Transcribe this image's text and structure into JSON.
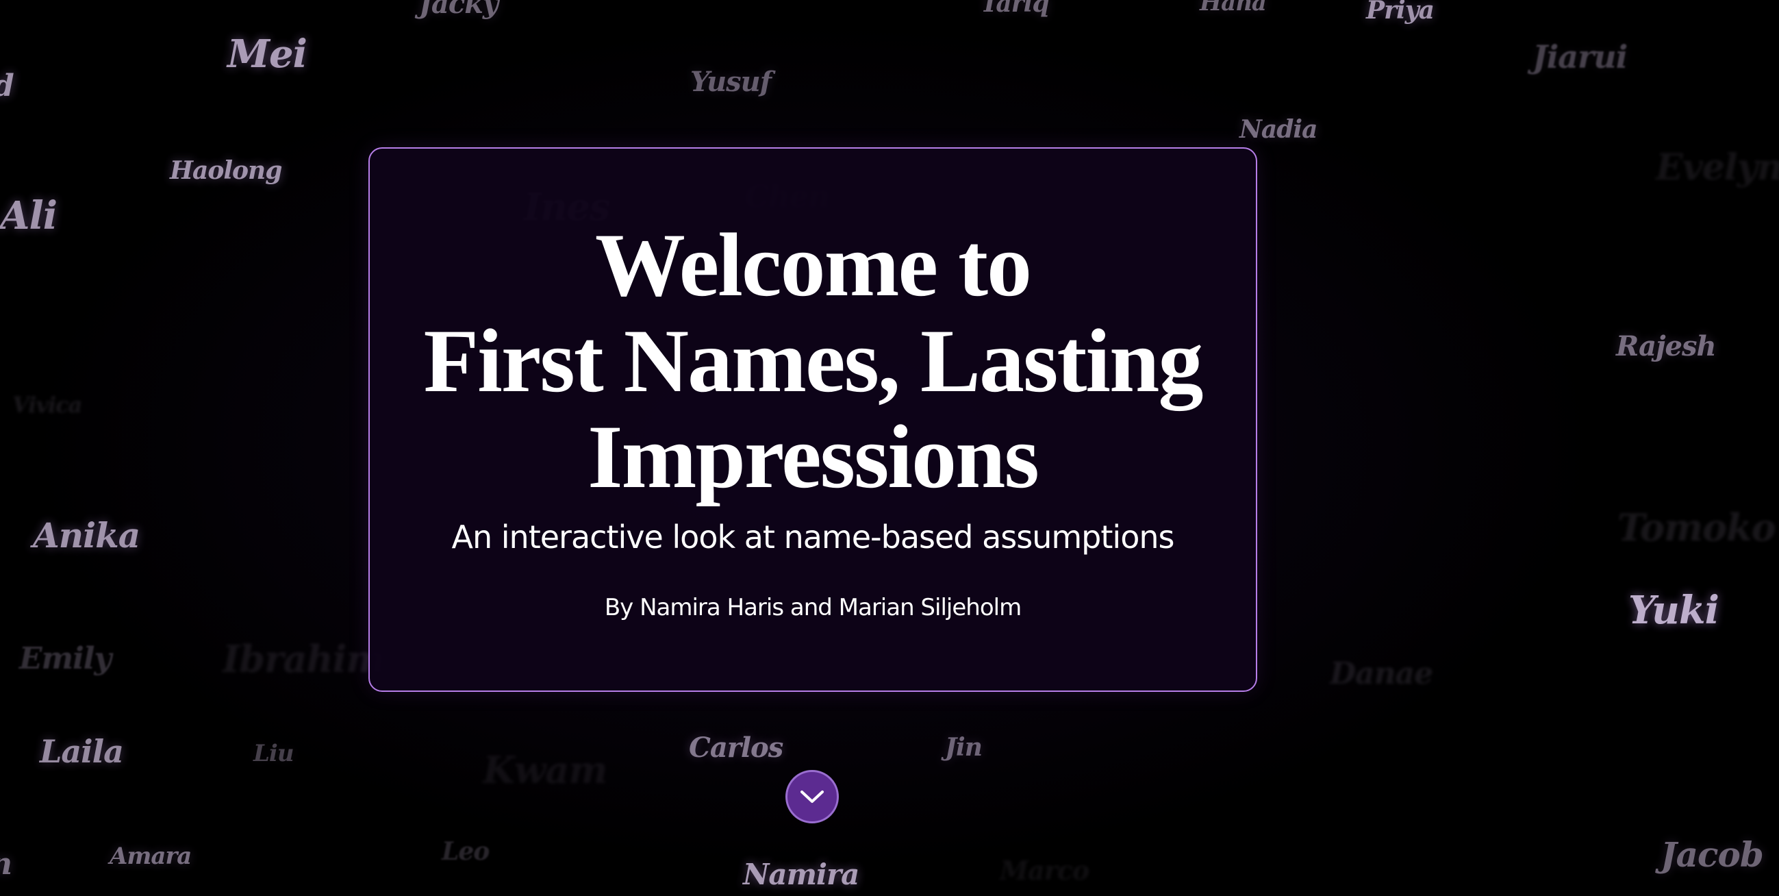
{
  "hero": {
    "title_line1": "Welcome to",
    "title_line2": "First Names, Lasting",
    "title_line3": "Impressions",
    "subtitle": "An interactive look at name-based assumptions",
    "byline": "By Namira Haris and Marian Siljeholm"
  },
  "scroll_button": {
    "icon": "chevron-down-icon"
  },
  "background_names": [
    "Jacky",
    "Tariq",
    "Hana",
    "Priya",
    "Mei",
    "Yusuf",
    "Jiarui",
    "d",
    "Nadia",
    "Haolong",
    "Evelyn",
    "Ines",
    "Chen",
    "Ali",
    "Rajesh",
    "Vivica",
    "Anika",
    "Tomoko",
    "Yuki",
    "Emily",
    "Ibrahim",
    "Danae",
    "Laila",
    "Liu",
    "Kwam",
    "Carlos",
    "Jin",
    "Amara",
    "Leo",
    "Namira",
    "Marco",
    "Jacob",
    "n"
  ],
  "colors": {
    "background": "#000000",
    "card_border": "#b67ee8",
    "card_background": "#0e0318",
    "button_fill": "#5c2b91",
    "name_text": "#c8b8d6"
  }
}
